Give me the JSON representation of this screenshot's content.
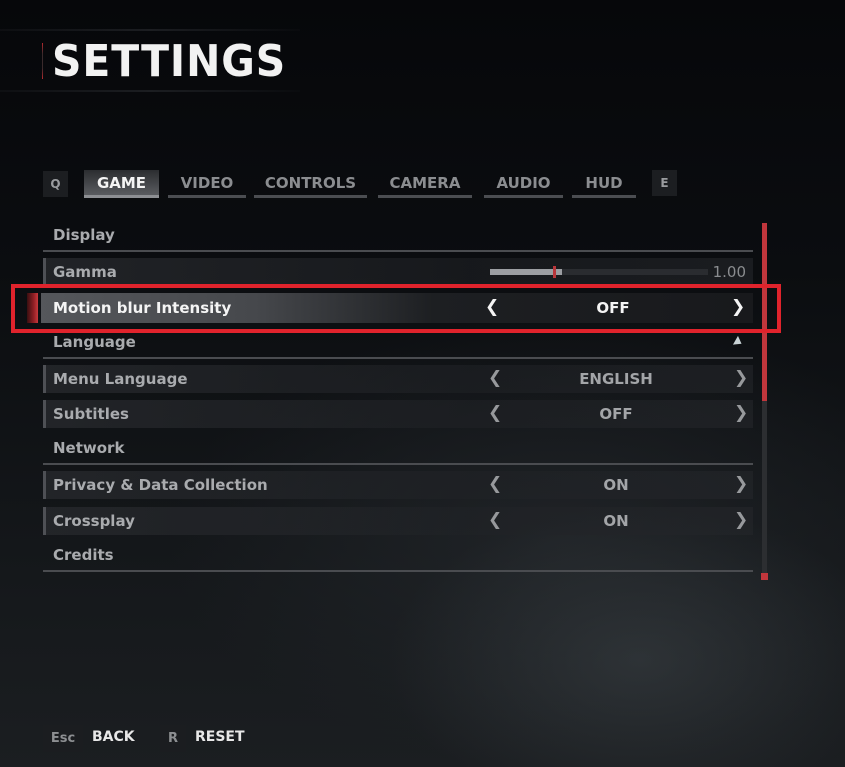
{
  "header": {
    "title": "SETTINGS"
  },
  "tabs": {
    "prev_key": "Q",
    "next_key": "E",
    "items": [
      {
        "label": "GAME",
        "active": true
      },
      {
        "label": "VIDEO",
        "active": false
      },
      {
        "label": "CONTROLS",
        "active": false
      },
      {
        "label": "CAMERA",
        "active": false
      },
      {
        "label": "AUDIO",
        "active": false
      },
      {
        "label": "HUD",
        "active": false
      }
    ]
  },
  "settings": {
    "sections": [
      {
        "title": "Display"
      },
      {
        "title": "Language"
      },
      {
        "title": "Network"
      },
      {
        "title": "Credits"
      }
    ],
    "gamma": {
      "label": "Gamma",
      "value": "1.00",
      "fill_fraction": 0.33,
      "marker_fraction": 0.29
    },
    "motion_blur": {
      "label": "Motion blur Intensity",
      "value": "OFF",
      "selected": true
    },
    "menu_language": {
      "label": "Menu Language",
      "value": "ENGLISH"
    },
    "subtitles": {
      "label": "Subtitles",
      "value": "OFF"
    },
    "privacy": {
      "label": "Privacy & Data Collection",
      "value": "ON"
    },
    "crossplay": {
      "label": "Crossplay",
      "value": "ON"
    },
    "arrow_left": "❮",
    "arrow_right": "❯"
  },
  "scrollbar": {
    "visible_fraction": 0.5,
    "position_fraction": 0.0
  },
  "footer": {
    "back_key": "Esc",
    "back_label": "BACK",
    "reset_key": "R",
    "reset_label": "RESET"
  },
  "colors": {
    "accent": "#e0232c",
    "selection_red": "#c1363c",
    "text_active": "#f4f4f4",
    "text_inactive": "#a9abae"
  }
}
